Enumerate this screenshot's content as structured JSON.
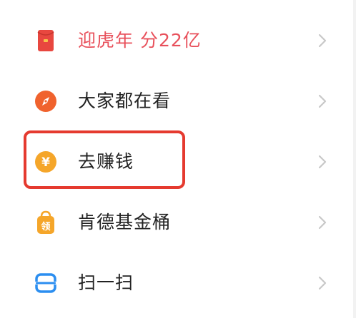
{
  "menu": {
    "items": [
      {
        "label": "迎虎年 分22亿",
        "icon": "red-envelope-icon",
        "style": "promo"
      },
      {
        "label": "大家都在看",
        "icon": "compass-icon",
        "style": "normal"
      },
      {
        "label": "去赚钱",
        "icon": "yuan-coin-icon",
        "style": "normal"
      },
      {
        "label": "肯德基金桶",
        "icon": "shopping-bag-icon",
        "style": "normal"
      },
      {
        "label": "扫一扫",
        "icon": "scan-icon",
        "style": "normal"
      }
    ]
  },
  "icon_glyphs": {
    "yuan": "¥",
    "bag": "领"
  },
  "colors": {
    "promo_text": "#e8505b",
    "red_envelope": "#e8473f",
    "compass": "#f0622d",
    "coin": "#f5a62a",
    "bag": "#f5a62a",
    "scan": "#2b8ef0",
    "highlight": "#e53a2f",
    "chevron": "#c8c8c8"
  }
}
